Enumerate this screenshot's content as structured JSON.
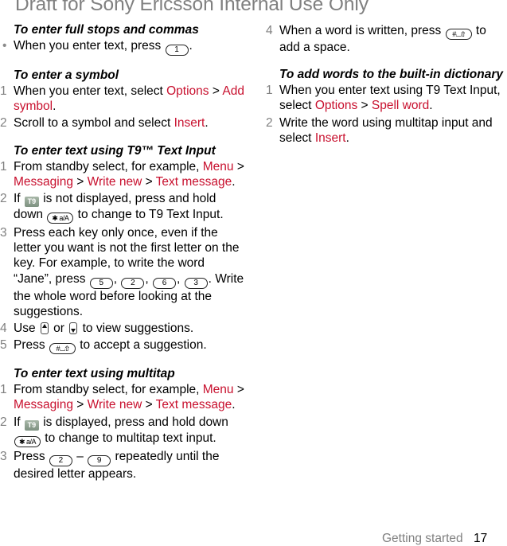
{
  "watermark": "Draft for Sony Ericsson Internal Use Only",
  "colors": {
    "link": "#c8102e",
    "muted": "#808080"
  },
  "left": {
    "full_stops": {
      "heading": "To enter full stops and commas",
      "bullet": {
        "a": "When you enter text, press ",
        "key": "1",
        "b": "."
      }
    },
    "symbol": {
      "heading": "To enter a symbol",
      "steps": [
        {
          "n": "1",
          "a": "When you enter text, select ",
          "l1": "Options",
          "s": " > ",
          "l2": "Add symbol",
          "b": "."
        },
        {
          "n": "2",
          "a": "Scroll to a symbol and select ",
          "l1": "Insert",
          "b": "."
        }
      ]
    },
    "t9": {
      "heading": "To enter text using T9™ Text Input",
      "step1": {
        "n": "1",
        "a": "From standby select, for example, ",
        "l1": "Menu",
        "l2": "Messaging",
        "l3": "Write new",
        "l4": "Text message",
        "sep": " > ",
        "b": "."
      },
      "step2": {
        "n": "2",
        "a": "If ",
        "icon": "T9",
        "b": " is not displayed, press and hold down ",
        "key": "✱ a/A",
        "c": " to change to T9 Text Input."
      },
      "step3": {
        "n": "3",
        "a": "Press each key only once, even if the letter you want is not the first letter on the key. For example, to write the word “Jane”, press ",
        "keys": [
          "5",
          "2",
          "6",
          "3"
        ],
        "b": ". Write the whole word before looking at the suggestions."
      },
      "step4": {
        "n": "4",
        "a": "Use ",
        "or": " or ",
        "b": " to view suggestions."
      },
      "step5": {
        "n": "5",
        "a": "Press ",
        "key": "#⌴⇧",
        "b": " to accept a suggestion."
      }
    },
    "multitap": {
      "heading": "To enter text using multitap",
      "step1": {
        "n": "1",
        "a": "From standby select, for example, ",
        "l1": "Menu",
        "l2": "Messaging",
        "l3": "Write new",
        "l4": "Text message",
        "sep": " > ",
        "b": "."
      },
      "step2": {
        "n": "2",
        "a": "If ",
        "icon": "T9",
        "b": " is displayed, press and hold down ",
        "key": "✱ a/A",
        "c": " to change to multitap text input."
      },
      "step3": {
        "n": "3",
        "a": "Press ",
        "key1": "2",
        "dash": " – ",
        "key2": "9",
        "b": " repeatedly until the desired letter appears."
      }
    }
  },
  "right": {
    "step4": {
      "n": "4",
      "a": "When a word is written, press ",
      "key": "#⌴⇧",
      "b": " to add a space."
    },
    "dictionary": {
      "heading": "To add words to the built-in dictionary",
      "steps": [
        {
          "n": "1",
          "a": "When you enter text using T9 Text Input, select ",
          "l1": "Options",
          "s": " > ",
          "l2": "Spell word",
          "b": "."
        },
        {
          "n": "2",
          "a": "Write the word using multitap input and select ",
          "l1": "Insert",
          "b": "."
        }
      ]
    }
  },
  "footer": {
    "section": "Getting started",
    "page": "17"
  }
}
